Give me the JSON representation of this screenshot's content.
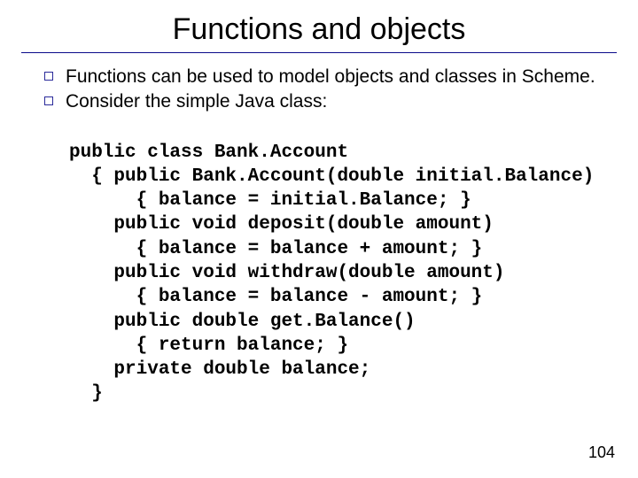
{
  "title": "Functions and objects",
  "bullets": [
    "Functions can be used to model objects and classes in Scheme.",
    "Consider the simple Java class:"
  ],
  "code": "public class Bank.Account\n  { public Bank.Account(double initial.Balance)\n      { balance = initial.Balance; }\n    public void deposit(double amount)\n      { balance = balance + amount; }\n    public void withdraw(double amount)\n      { balance = balance - amount; }\n    public double get.Balance()\n      { return balance; }\n    private double balance;\n  }",
  "page_number": "104"
}
